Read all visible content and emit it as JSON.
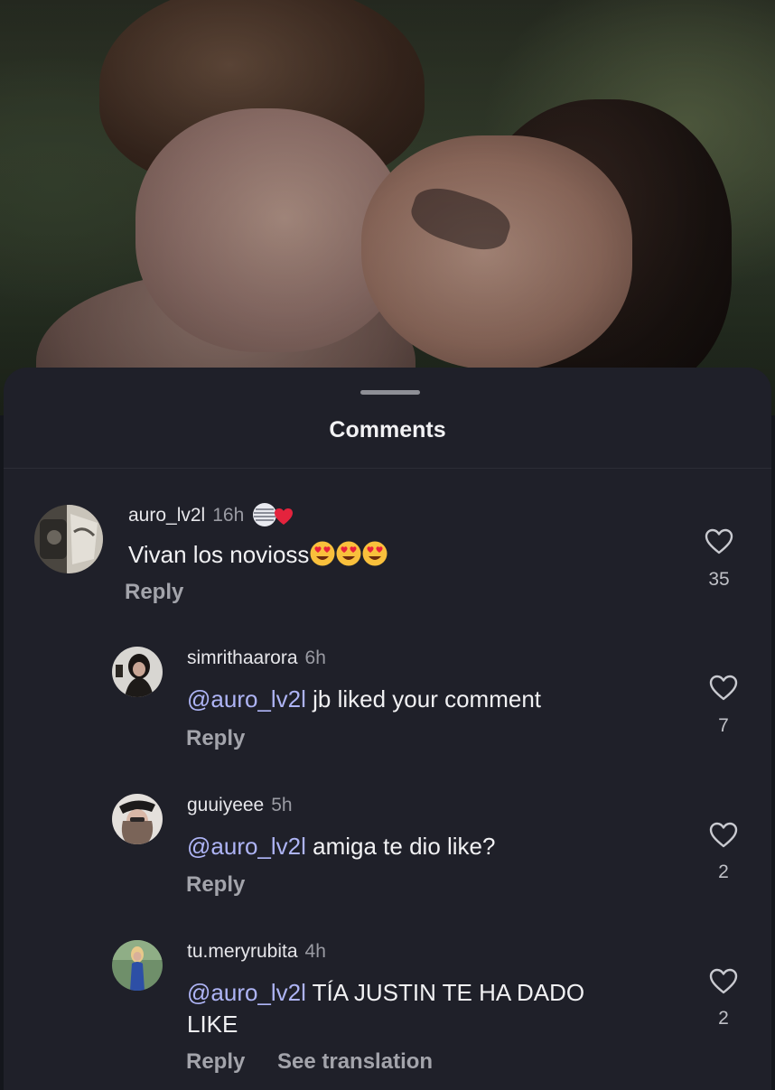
{
  "sheet": {
    "title": "Comments"
  },
  "comments": [
    {
      "username": "auro_lv2l",
      "time": "16h",
      "text": "Vivan los novioss",
      "emoji_icons": [
        "smiling-face-with-heart-eyes-icon",
        "smiling-face-with-heart-eyes-icon",
        "smiling-face-with-heart-eyes-icon"
      ],
      "badge_icon": "striped-badge-with-heart-icon",
      "reply_label": "Reply",
      "likes": "35"
    },
    {
      "username": "simrithaarora",
      "time": "6h",
      "mention": "@auro_lv2l",
      "text": "jb liked your comment",
      "reply_label": "Reply",
      "likes": "7"
    },
    {
      "username": "guuiyeee",
      "time": "5h",
      "mention": "@auro_lv2l",
      "text": "amiga te dio like?",
      "reply_label": "Reply",
      "likes": "2"
    },
    {
      "username": "tu.meryrubita",
      "time": "4h",
      "mention": "@auro_lv2l",
      "text_line1": "TÍA JUSTIN TE HA DADO",
      "text_line2": "LIKE",
      "reply_label": "Reply",
      "see_translation_label": "See translation",
      "likes": "2"
    }
  ],
  "colors": {
    "sheet_bg": "#1f2029",
    "mention": "#aeb4f5",
    "secondary_text": "#a3a4ab",
    "primary_text": "#f1f1f3"
  }
}
